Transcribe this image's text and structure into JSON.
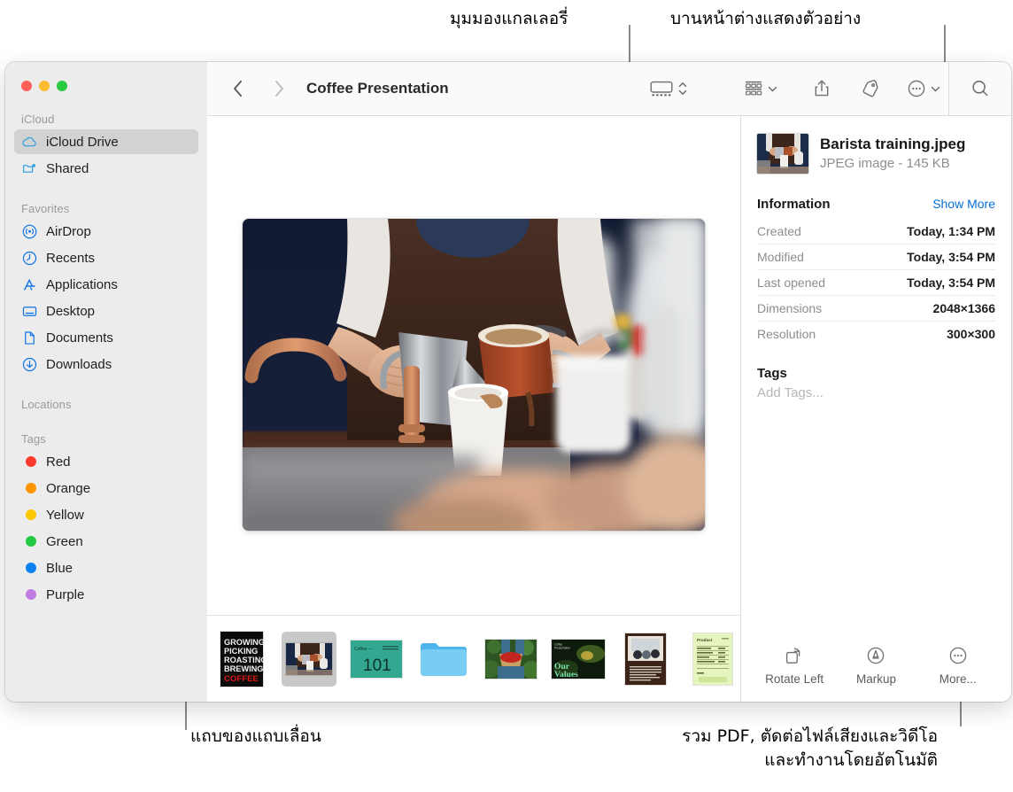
{
  "annotations": [
    {
      "id": "gallery-view",
      "text": "มุมมองแกลเลอรี่"
    },
    {
      "id": "preview-pane",
      "text": "บานหน้าต่างแสดงตัวอย่าง"
    },
    {
      "id": "scroll-strip",
      "text": "แถบของแถบเลื่อน"
    },
    {
      "id": "more-actions",
      "text": "รวม PDF, ตัดต่อไฟล์เสียงและวิดีโอ\nและทำงานโดยอัตโนมัติ"
    }
  ],
  "window": {
    "title": "Coffee Presentation",
    "traffic_lights": {
      "close": "close-button",
      "minimize": "minimize-button",
      "zoom": "zoom-button",
      "close_color": "#ff5f57",
      "minimize_color": "#febc2e",
      "zoom_color": "#28c840"
    }
  },
  "toolbar": {
    "back": "chevron-left-icon",
    "forward": "chevron-right-icon",
    "view_gallery": "gallery-view-icon",
    "view_stepper": "chevron-up-down-icon",
    "group_by": "group-by-icon",
    "group_by_chevron": "chevron-down-icon",
    "share": "share-icon",
    "tag": "tag-icon",
    "more": "more-circle-icon",
    "more_chevron": "chevron-down-icon",
    "search": "search-icon"
  },
  "sidebar": {
    "sections": [
      {
        "label": "iCloud",
        "items": [
          {
            "label": "iCloud Drive",
            "icon": "icloud-icon",
            "selected": true
          },
          {
            "label": "Shared",
            "icon": "shared-folder-icon",
            "selected": false
          }
        ]
      },
      {
        "label": "Favorites",
        "items": [
          {
            "label": "AirDrop",
            "icon": "airdrop-icon",
            "selected": false
          },
          {
            "label": "Recents",
            "icon": "recents-clock-icon",
            "selected": false
          },
          {
            "label": "Applications",
            "icon": "applications-icon",
            "selected": false
          },
          {
            "label": "Desktop",
            "icon": "desktop-icon",
            "selected": false
          },
          {
            "label": "Documents",
            "icon": "document-icon",
            "selected": false
          },
          {
            "label": "Downloads",
            "icon": "downloads-icon",
            "selected": false
          }
        ]
      },
      {
        "label": "Locations",
        "items": []
      },
      {
        "label": "Tags",
        "items": [
          {
            "label": "Red",
            "icon": "tag-dot-icon",
            "color": "#fc3b2d"
          },
          {
            "label": "Orange",
            "icon": "tag-dot-icon",
            "color": "#fc9500"
          },
          {
            "label": "Yellow",
            "icon": "tag-dot-icon",
            "color": "#fdc700"
          },
          {
            "label": "Green",
            "icon": "tag-dot-icon",
            "color": "#21c councils"
          },
          {
            "label": "Blue",
            "icon": "tag-dot-icon",
            "color": "#0b82f0"
          },
          {
            "label": "Purple",
            "icon": "tag-dot-icon",
            "color": "#c munic"
          }
        ]
      }
    ]
  },
  "preview": {
    "alt": "barista pouring milk from a metal pitcher into a paper cup"
  },
  "filmstrip": {
    "items": [
      {
        "name": "coffee-poster-thumbnail",
        "type": "poster",
        "selected": false,
        "lines": [
          "GROWING",
          "PICKING",
          "ROASTING",
          "BREWING",
          "COFFEE"
        ]
      },
      {
        "name": "barista-photo-thumbnail",
        "type": "photo",
        "selected": true
      },
      {
        "name": "coffee-101-slide-thumbnail",
        "type": "slide",
        "selected": false,
        "heading": "Coffee —",
        "big": "101"
      },
      {
        "name": "folder-thumbnail",
        "type": "folder",
        "selected": false
      },
      {
        "name": "berries-photo-thumbnail",
        "type": "photo2",
        "selected": false
      },
      {
        "name": "our-values-slide-thumbnail",
        "type": "values",
        "selected": false,
        "title": "Our\nValues"
      },
      {
        "name": "meeting-document-thumbnail",
        "type": "doc",
        "selected": false
      },
      {
        "name": "receipt-document-thumbnail",
        "type": "receipt",
        "selected": false
      }
    ]
  },
  "inspector": {
    "file_name": "Barista training.jpeg",
    "file_meta": "JPEG image - 145 KB",
    "information_heading": "Information",
    "show_more": "Show More",
    "info_rows": [
      {
        "key": "Created",
        "value": "Today, 1:34 PM"
      },
      {
        "key": "Modified",
        "value": "Today, 3:54 PM"
      },
      {
        "key": "Last opened",
        "value": "Today, 3:54 PM"
      },
      {
        "key": "Dimensions",
        "value": "2048×1366"
      },
      {
        "key": "Resolution",
        "value": "300×300"
      }
    ],
    "tags_heading": "Tags",
    "add_tags_placeholder": "Add Tags...",
    "actions": [
      {
        "label": "Rotate Left",
        "icon": "rotate-left-icon"
      },
      {
        "label": "Markup",
        "icon": "markup-pen-icon"
      },
      {
        "label": "More...",
        "icon": "more-circle-icon"
      }
    ]
  },
  "colors": {
    "accent_blue": "#066fd6",
    "sidebar_bg": "#ececec",
    "toolbar_bg": "#fafafa",
    "selection": "#d2d2d2"
  }
}
